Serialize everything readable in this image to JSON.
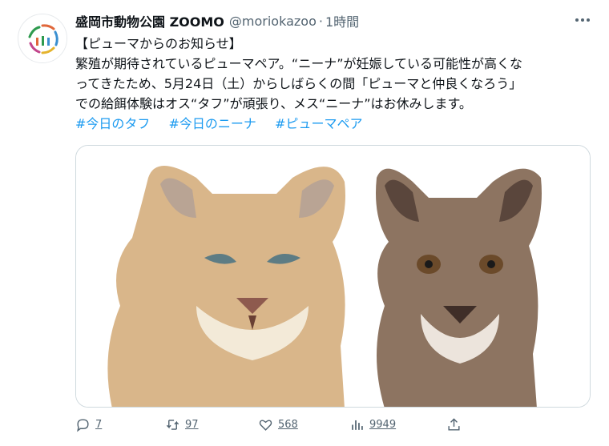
{
  "tweet": {
    "author_name": "盛岡市動物公園 ZOOMO",
    "handle": "@moriokazoo",
    "separator": "·",
    "time": "1時間",
    "lines": [
      "【ピューマからのお知らせ】",
      "繁殖が期待されているピューマペア。“ニーナ”が妊娠している可能性が高くな",
      "ってきたため、5月24日（土）からしばらくの間「ピューマと仲良くなろう」",
      "での給餌体験はオス“タフ”が頑張り、メス“ニーナ”はお休みします。"
    ],
    "hashtags": [
      "#今日のタフ",
      "#今日のニーナ",
      "#ピューマペア"
    ],
    "media": {
      "left_subject": "puma-tough",
      "right_subject": "puma-nina"
    }
  },
  "actions": {
    "reply_count": "7",
    "retweet_count": "97",
    "like_count": "568",
    "view_count": "9949"
  },
  "colors": {
    "accent": "#1d9bf0",
    "text": "#0f1419",
    "secondary": "#536471",
    "border": "#cfd9de"
  }
}
